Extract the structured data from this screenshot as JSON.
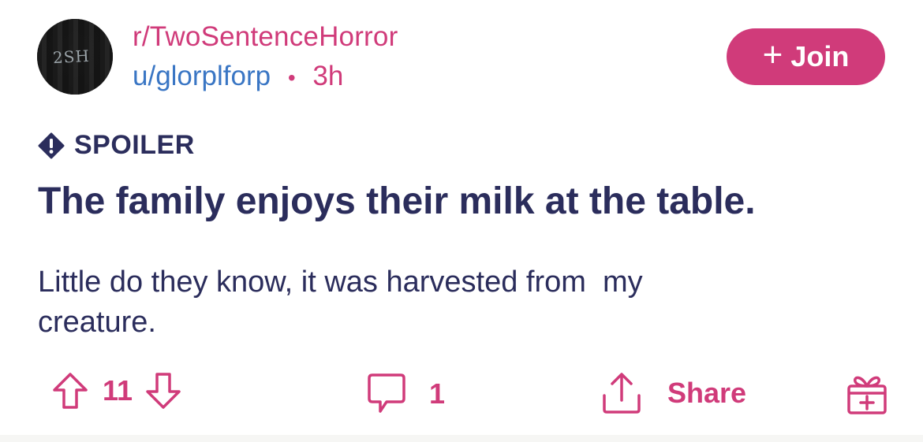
{
  "post": {
    "avatar_text": "2SH",
    "subreddit": "r/TwoSentenceHorror",
    "user": "u/glorplforp",
    "separator": "•",
    "time": "3h",
    "join_plus": "+",
    "join_label": "Join",
    "flair": "SPOILER",
    "title": "The family enjoys their milk at the table.",
    "body": "Little do they know, it was harvested from  my\ncreature."
  },
  "actions": {
    "upvotes": "11",
    "comments": "1",
    "share_label": "Share"
  },
  "icons": {
    "spoiler": "exclamation-diamond-icon",
    "upvote": "arrow-up-icon",
    "downvote": "arrow-down-icon",
    "comment": "speech-bubble-icon",
    "share": "share-upload-icon",
    "gift": "gift-box-icon"
  },
  "colors": {
    "accent": "#d03b7a",
    "username": "#3a76c4",
    "text": "#2b2d5c",
    "background": "#ffffff"
  }
}
